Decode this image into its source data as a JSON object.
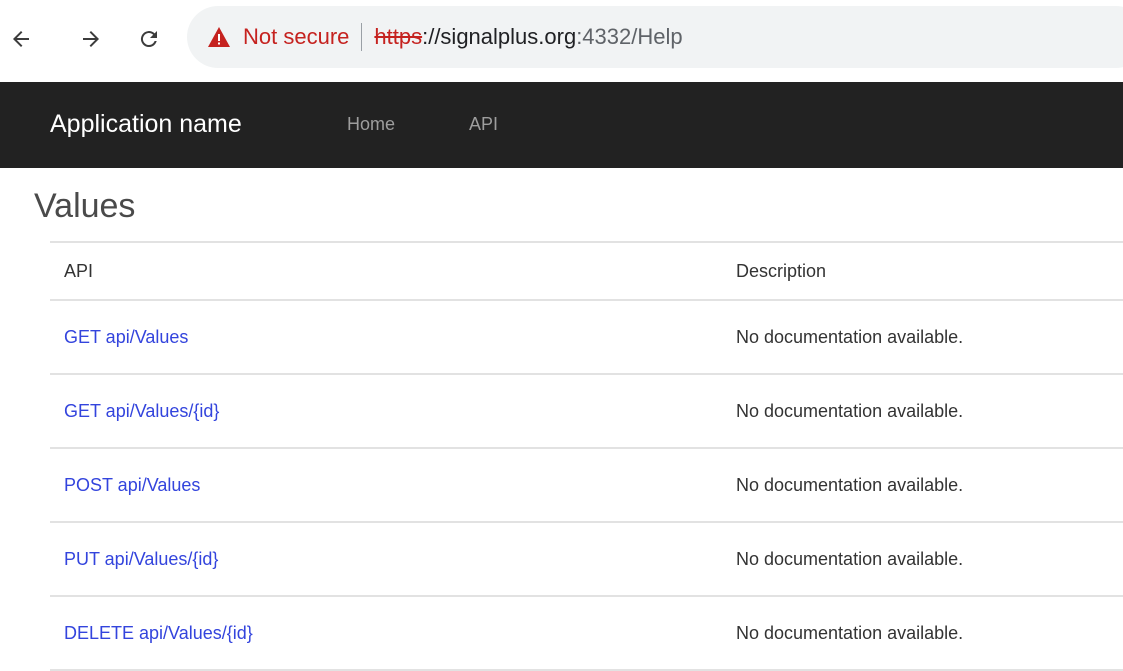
{
  "browser": {
    "security_label": "Not secure",
    "url_scheme": "https",
    "url_rest_host": "://signalplus.org",
    "url_port_path": ":4332/Help",
    "colors": {
      "warning": "#c5221f",
      "omnibox_bg": "#f1f3f4"
    }
  },
  "navbar": {
    "brand": "Application name",
    "links": [
      "Home",
      "API"
    ],
    "background": "#222222"
  },
  "page": {
    "heading": "Values"
  },
  "table": {
    "columns": [
      "API",
      "Description"
    ],
    "rows": [
      {
        "api": "GET api/Values",
        "description": "No documentation available."
      },
      {
        "api": "GET api/Values/{id}",
        "description": "No documentation available."
      },
      {
        "api": "POST api/Values",
        "description": "No documentation available."
      },
      {
        "api": "PUT api/Values/{id}",
        "description": "No documentation available."
      },
      {
        "api": "DELETE api/Values/{id}",
        "description": "No documentation available."
      }
    ],
    "link_color": "#3344dd"
  }
}
